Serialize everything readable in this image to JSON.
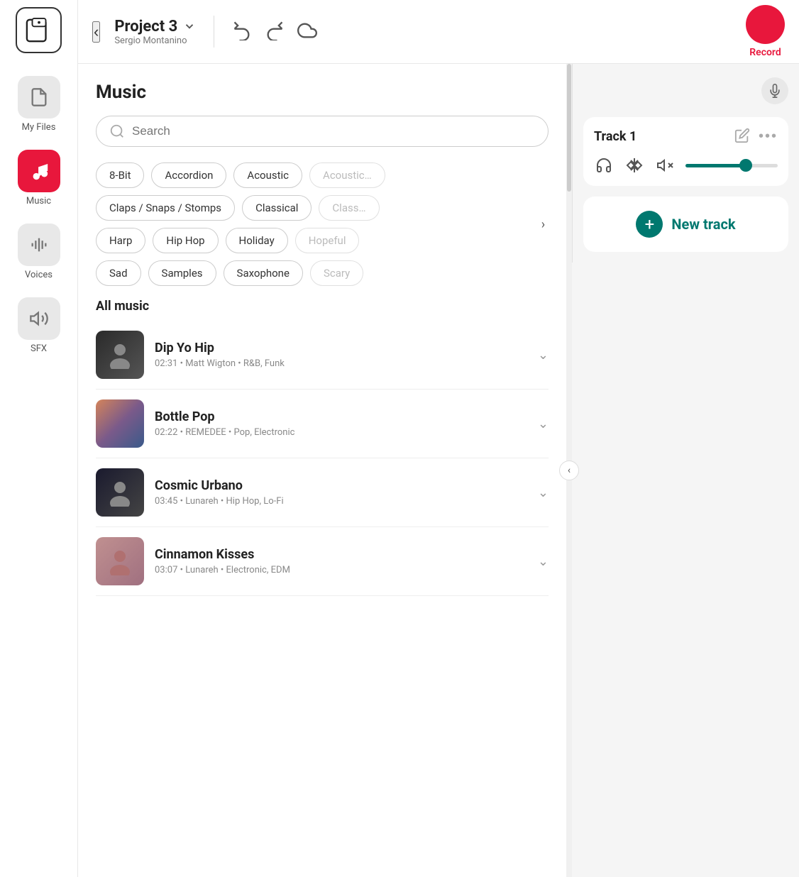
{
  "sidebar": {
    "logo_label": "Logo",
    "items": [
      {
        "id": "my-files",
        "label": "My Files",
        "active": false,
        "icon": "file-icon"
      },
      {
        "id": "music",
        "label": "Music",
        "active": true,
        "icon": "music-icon"
      },
      {
        "id": "voices",
        "label": "Voices",
        "active": false,
        "icon": "waveform-icon"
      },
      {
        "id": "sfx",
        "label": "SFX",
        "active": false,
        "icon": "sfx-icon"
      }
    ]
  },
  "header": {
    "back_label": "‹",
    "project_title": "Project 3",
    "project_subtitle": "Sergio Montanino",
    "record_label": "Record"
  },
  "music_panel": {
    "title": "Music",
    "search_placeholder": "Search",
    "filter_chips": [
      {
        "label": "8-Bit",
        "faded": false
      },
      {
        "label": "Accordion",
        "faded": false
      },
      {
        "label": "Acoustic",
        "faded": false
      },
      {
        "label": "Acoustic Guitar",
        "faded": true
      },
      {
        "label": "Claps / Snaps / Stomps",
        "faded": false
      },
      {
        "label": "Classical",
        "faded": false
      },
      {
        "label": "Classic Rock",
        "faded": true
      },
      {
        "label": "Harp",
        "faded": false
      },
      {
        "label": "Hip Hop",
        "faded": false
      },
      {
        "label": "Holiday",
        "faded": false
      },
      {
        "label": "Hopeful",
        "faded": true
      },
      {
        "label": "Sad",
        "faded": false
      },
      {
        "label": "Samples",
        "faded": false
      },
      {
        "label": "Saxophone",
        "faded": false
      },
      {
        "label": "Scary",
        "faded": true
      }
    ],
    "all_music_label": "All music",
    "tracks": [
      {
        "id": "dip-yo-hip",
        "name": "Dip Yo Hip",
        "duration": "02:31",
        "artist": "Matt Wigton",
        "genre": "R&B, Funk",
        "thumb_type": "dip"
      },
      {
        "id": "bottle-pop",
        "name": "Bottle Pop",
        "duration": "02:22",
        "artist": "REMEDEE",
        "genre": "Pop, Electronic",
        "thumb_type": "bottle"
      },
      {
        "id": "cosmic-urbano",
        "name": "Cosmic Urbano",
        "duration": "03:45",
        "artist": "Lunareh",
        "genre": "Hip Hop, Lo-Fi",
        "thumb_type": "cosmic"
      },
      {
        "id": "cinnamon-kisses",
        "name": "Cinnamon Kisses",
        "duration": "03:07",
        "artist": "Lunareh",
        "genre": "Electronic, EDM",
        "thumb_type": "cinnamon"
      }
    ]
  },
  "right_panel": {
    "track_card": {
      "title": "Track 1",
      "edit_label": "✏",
      "more_label": "•••",
      "volume_percent": 65
    },
    "new_track_label": "New track",
    "new_track_plus": "+"
  }
}
